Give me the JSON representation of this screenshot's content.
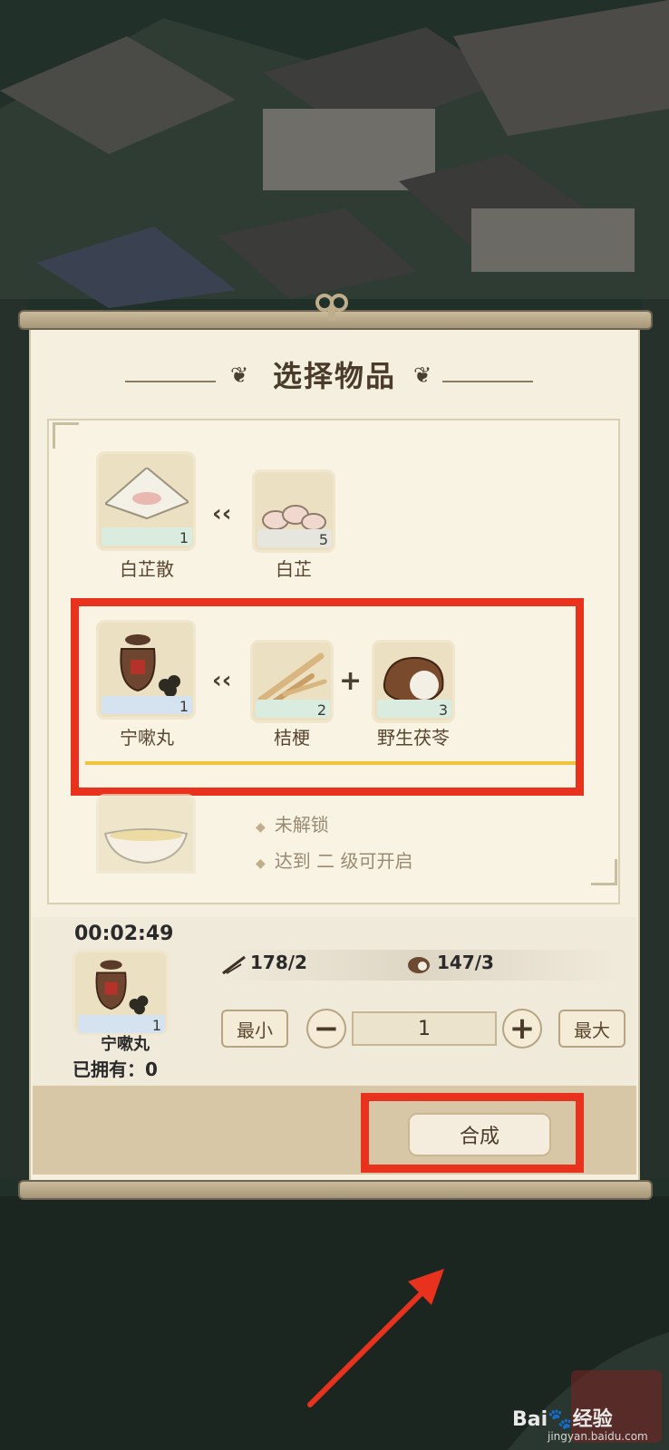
{
  "dialog": {
    "title": "选择物品"
  },
  "recipes": [
    {
      "product": {
        "name": "白芷散",
        "count": "1",
        "icon": "powder-packet-icon"
      },
      "ingredients": [
        {
          "name": "白芷",
          "count": "5",
          "icon": "angelica-root-slices-icon"
        }
      ]
    },
    {
      "product": {
        "name": "宁嗽丸",
        "count": "1",
        "icon": "pill-jar-icon"
      },
      "ingredients": [
        {
          "name": "桔梗",
          "count": "2",
          "icon": "platycodon-root-icon"
        },
        {
          "name": "野生茯苓",
          "count": "3",
          "icon": "poria-mushroom-icon"
        }
      ],
      "selected": true
    },
    {
      "product": {
        "icon": "soup-bowl-icon"
      },
      "locked_text": "未解锁",
      "unlock_hint": "达到 二 级可开启"
    }
  ],
  "craft_panel": {
    "timer": "00:02:49",
    "item_name": "宁嗽丸",
    "item_count": "1",
    "owned_label": "已拥有：0",
    "resources": [
      {
        "icon": "platycodon-root-icon",
        "value": "178/2"
      },
      {
        "icon": "poria-mushroom-icon",
        "value": "147/3"
      }
    ],
    "min_label": "最小",
    "max_label": "最大",
    "quantity": "1",
    "craft_label": "合成"
  },
  "watermark": {
    "brand": "Bai",
    "brand_cn": "经验",
    "url": "jingyan.baidu.com"
  },
  "colors": {
    "highlight_red": "#e8321e",
    "selection_gold": "#f0c33a",
    "paper": "#f4efdf"
  }
}
